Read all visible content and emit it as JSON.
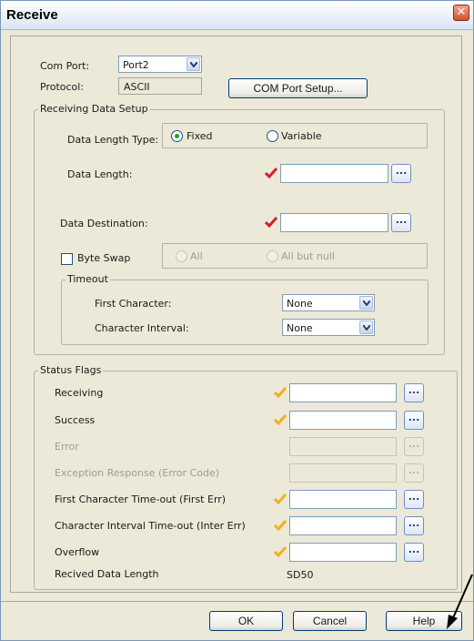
{
  "window": {
    "title": "Receive",
    "close_label": "✕"
  },
  "com": {
    "com_port_label": "Com Port:",
    "com_port_value": "Port2",
    "protocol_label": "Protocol:",
    "protocol_value": "ASCII",
    "setup_button": "COM Port Setup..."
  },
  "receiving": {
    "group_title": "Receiving Data Setup",
    "length_type_label": "Data Length Type:",
    "fixed_label": "Fixed",
    "variable_label": "Variable",
    "data_length_label": "Data Length:",
    "data_length_value": "",
    "data_destination_label": "Data Destination:",
    "data_destination_value": "",
    "byte_swap_label": "Byte Swap",
    "all_label": "All",
    "all_but_null_label": "All but null",
    "timeout_title": "Timeout",
    "first_char_label": "First Character:",
    "first_char_value": "None",
    "char_interval_label": "Character Interval:",
    "char_interval_value": "None",
    "browse_label": "..."
  },
  "status": {
    "group_title": "Status Flags",
    "rows": [
      {
        "label": "Receiving",
        "enabled": true
      },
      {
        "label": "Success",
        "enabled": true
      },
      {
        "label": "Error",
        "enabled": false
      },
      {
        "label": "Exception Response (Error Code)",
        "enabled": false
      },
      {
        "label": "First Character Time-out (First Err)",
        "enabled": true
      },
      {
        "label": "Character Interval Time-out (Inter Err)",
        "enabled": true
      },
      {
        "label": "Overflow",
        "enabled": true
      }
    ],
    "received_length_label": "Recived Data Length",
    "received_length_value": "SD50"
  },
  "buttons": {
    "ok": "OK",
    "cancel": "Cancel",
    "help": "Help"
  },
  "colors": {
    "required_check": "#d0202a",
    "optional_check": "#f0b020",
    "dialog_bg": "#ece9d8"
  }
}
